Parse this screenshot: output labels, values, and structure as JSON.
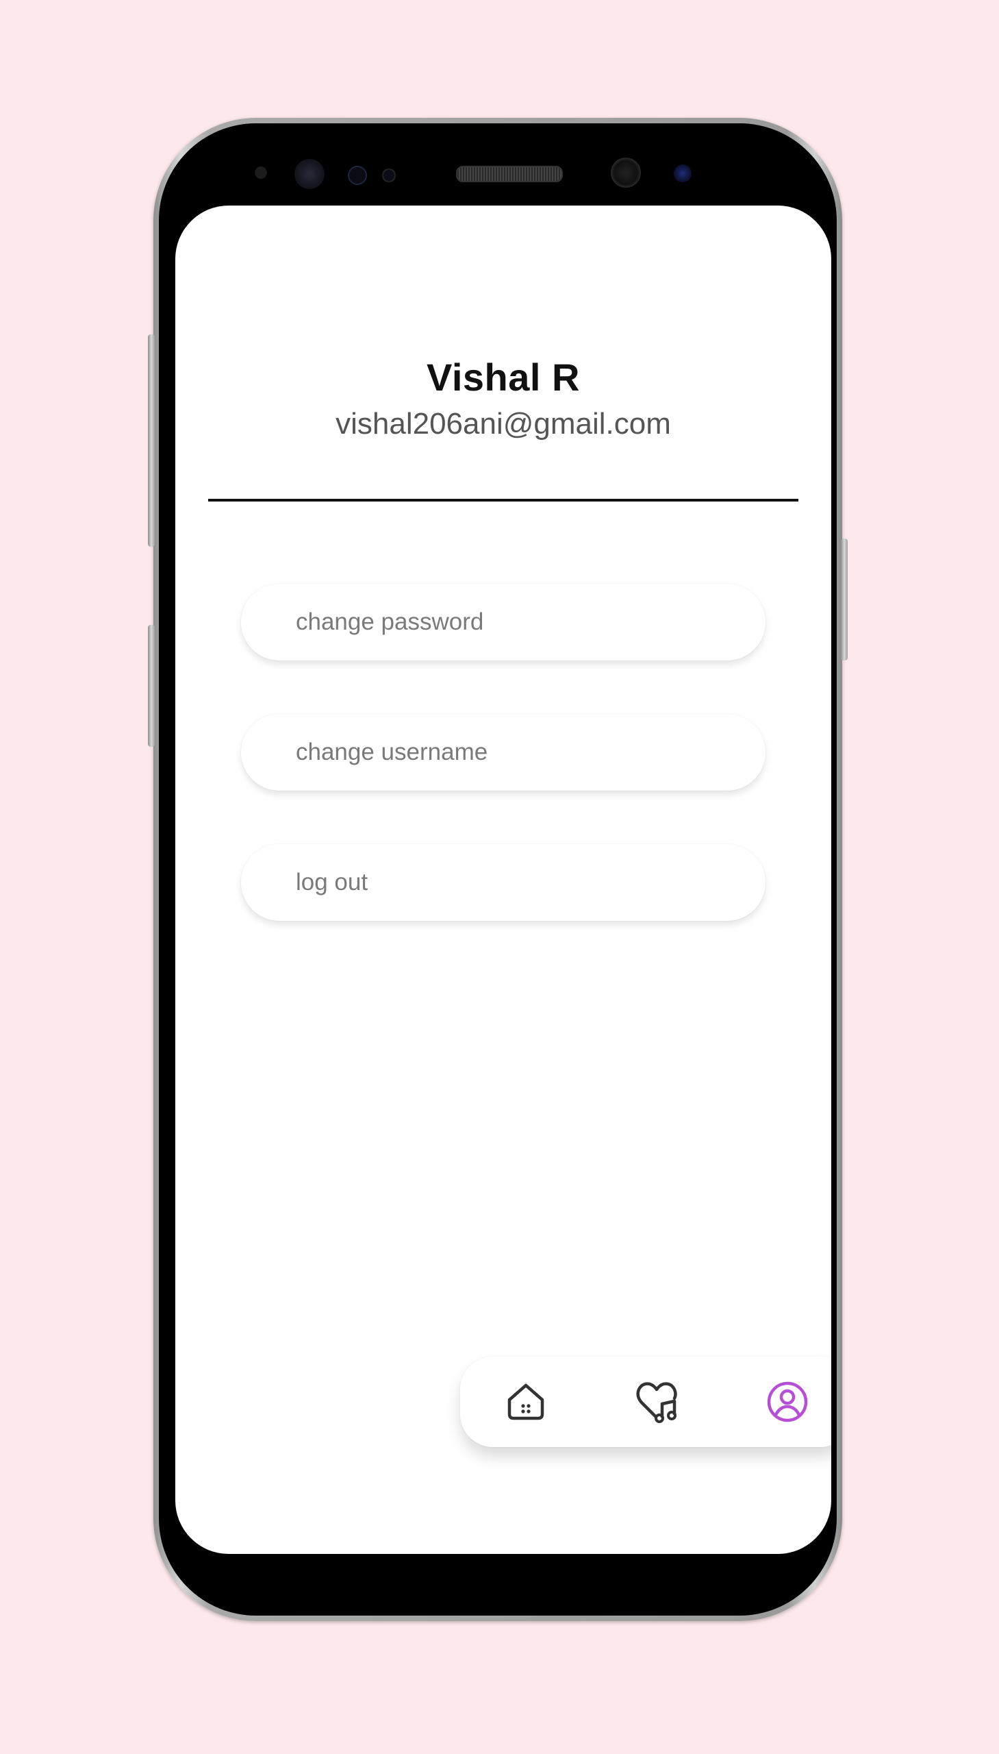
{
  "profile": {
    "name": "Vishal R",
    "email": "vishal206ani@gmail.com"
  },
  "options": [
    {
      "label": "change password"
    },
    {
      "label": "change username"
    },
    {
      "label": "log out"
    }
  ],
  "nav": {
    "items": [
      {
        "icon": "home-icon",
        "active": false
      },
      {
        "icon": "heart-music-icon",
        "active": false
      },
      {
        "icon": "profile-icon",
        "active": true
      }
    ]
  },
  "colors": {
    "background": "#fde9eb",
    "accent": "#b64fd6",
    "icon_default": "#333333"
  }
}
